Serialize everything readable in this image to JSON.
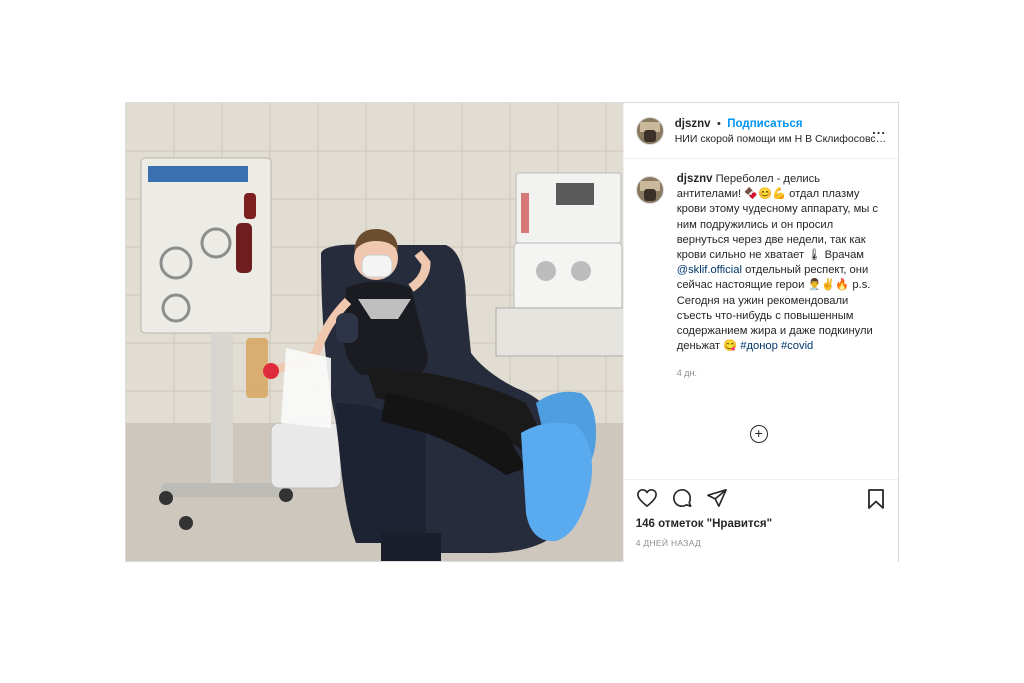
{
  "post": {
    "username": "djsznv",
    "follow_label": "Подписаться",
    "separator": "•",
    "location": "НИИ скорой помощи им Н В Склифосовского",
    "more_label": "...",
    "caption": {
      "text_1": "Переболел - делись антителами! ",
      "emoji_1": "🍫😊💪",
      "text_2": " отдал плазму крови этому чудесному аппарату, мы с ним подружились и он просил вернуться через две недели, так как крови сильно не хватает ",
      "emoji_2": "🌡",
      "text_3": " Врачам ",
      "mention": "@sklif.official",
      "text_4": " отдельный респект, они сейчас настоящие герои ",
      "emoji_3": "👨‍⚕️✌🔥",
      "text_5": " p.s. Сегодня на ужин рекомендовали съесть что-нибудь с повышенным содержанием жира и даже подкинули деньжат ",
      "emoji_4": "😋",
      "hashtag_1": "#донор",
      "hashtag_2": "#covid"
    },
    "caption_time": "4 дн.",
    "likes": "146 отметок \"Нравится\"",
    "time_ago": "4 ДНЕЙ НАЗАД"
  },
  "icons": {
    "heart": "heart-icon",
    "comment": "comment-icon",
    "share": "share-icon",
    "bookmark": "bookmark-icon",
    "load_more": "plus-circle-icon"
  },
  "colors": {
    "accent": "#0095f6",
    "link": "#00376b",
    "muted": "#8e8e8e",
    "text": "#262626",
    "border": "#dbdbdb"
  }
}
